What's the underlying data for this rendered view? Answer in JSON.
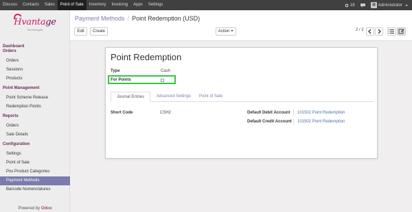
{
  "topbar": {
    "menu": [
      "Discuss",
      "Contacts",
      "Sales",
      "Point of Sale",
      "Inventory",
      "Invoicing",
      "Apps",
      "Settings"
    ],
    "active_index": 3,
    "notification_count": "18",
    "user": "Administrator"
  },
  "logo": {
    "main_prefix": "Hvanta",
    "main_suffix": "ge",
    "sub": "Technologies"
  },
  "sidebar": {
    "sections": [
      {
        "title": "Dashboard",
        "items": []
      },
      {
        "title": "Orders",
        "items": [
          "Orders",
          "Sessions",
          "Products"
        ]
      },
      {
        "title": "Point Management",
        "items": [
          "Point Scheme Release",
          "Redemption Points"
        ]
      },
      {
        "title": "Reports",
        "items": [
          "Orders",
          "Sale Details"
        ]
      },
      {
        "title": "Configuration",
        "items": [
          "Settings",
          "Point of Sale",
          "Pos Product Categories",
          "Payment Methods",
          "Barcode Nomenclatures"
        ]
      }
    ],
    "active_item": "Payment Methods",
    "powered_by": "Powered by",
    "brand": "Odoo"
  },
  "control_panel": {
    "breadcrumb_parent": "Payment Methods",
    "breadcrumb_separator": "/",
    "breadcrumb_current": "Point Redemption (USD)",
    "edit_label": "Edit",
    "create_label": "Create",
    "action_label": "Action",
    "pager": "2 / 2"
  },
  "form": {
    "title": "Point Redemption",
    "type_label": "Type",
    "type_value": "Cash",
    "for_points_label": "For Points",
    "for_points_checked": false,
    "tabs": [
      "Journal Entries",
      "Advanced Settings",
      "Point of Sale"
    ],
    "active_tab": 0,
    "short_code_label": "Short Code",
    "short_code_value": "CSH2",
    "debit_label": "Default Debit Account",
    "debit_value": "101502 Point Redemption",
    "credit_label": "Default Credit Account",
    "credit_value": "101502 Point Redemption"
  },
  "colors": {
    "topbar": "#404040",
    "accent": "#7c7bad",
    "highlight": "#2ec840",
    "link": "#4c6fa8"
  }
}
